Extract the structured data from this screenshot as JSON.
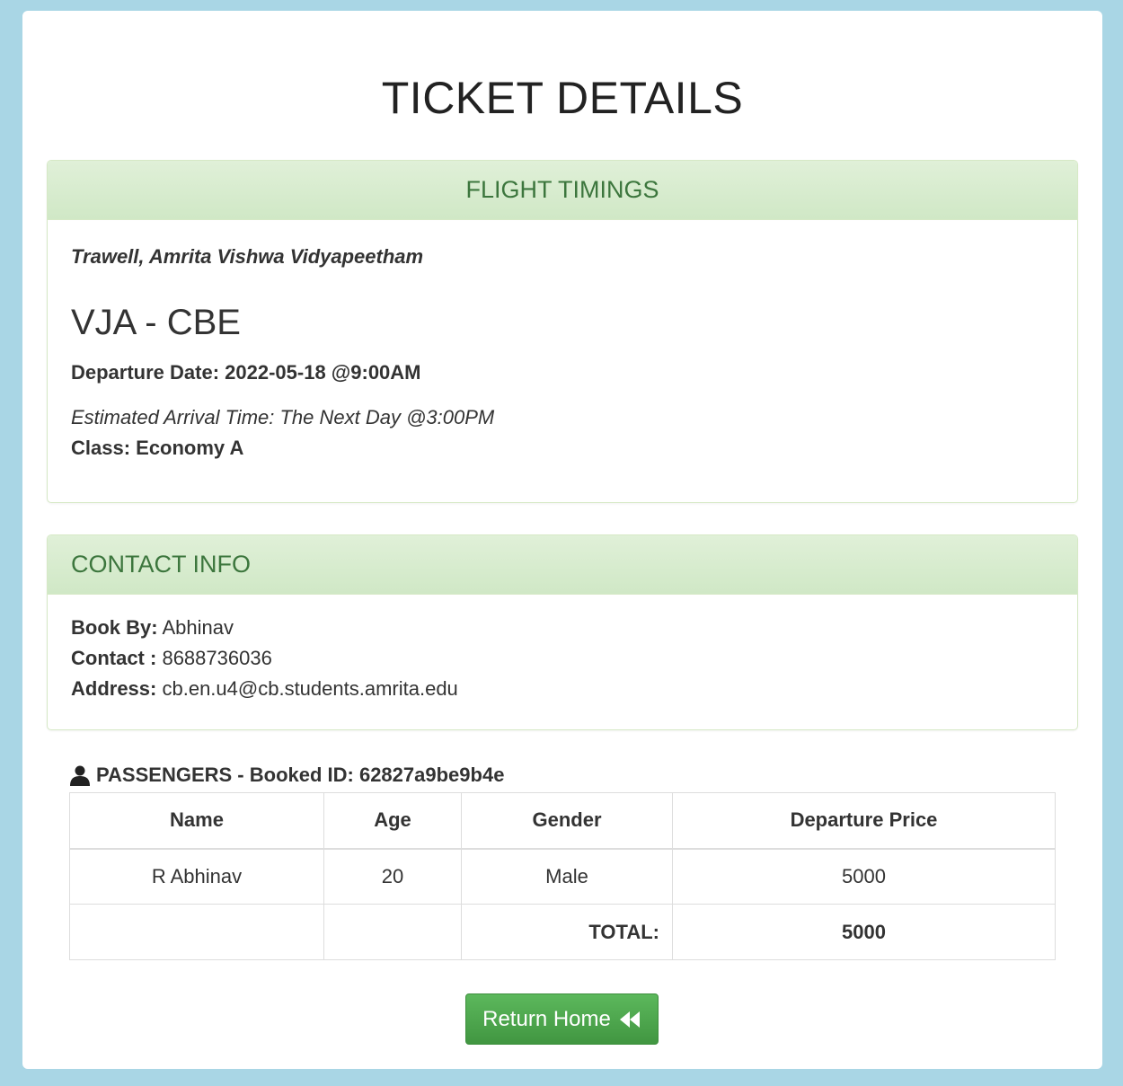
{
  "page": {
    "title": "TICKET DETAILS"
  },
  "flight": {
    "heading": "FLIGHT TIMINGS",
    "org": "Trawell, Amrita Vishwa Vidyapeetham",
    "route": "VJA - CBE",
    "departure": "Departure Date: 2022-05-18 @9:00AM",
    "arrival": "Estimated Arrival Time: The Next Day @3:00PM",
    "class": "Class: Economy A"
  },
  "contact": {
    "heading": "CONTACT INFO",
    "book_by_label": "Book By:",
    "book_by_value": "Abhinav",
    "contact_label": "Contact :",
    "contact_value": "8688736036",
    "address_label": "Address:",
    "address_value": "cb.en.u4@cb.students.amrita.edu"
  },
  "passengers": {
    "heading": "PASSENGERS - Booked ID: 62827a9be9b4e",
    "icon": "user-icon",
    "columns": [
      "Name",
      "Age",
      "Gender",
      "Departure Price"
    ],
    "rows": [
      {
        "name": "R Abhinav",
        "age": "20",
        "gender": "Male",
        "price": "5000"
      }
    ],
    "total_label": "TOTAL:",
    "total_value": "5000"
  },
  "actions": {
    "return_home": "Return Home",
    "return_icon": "rewind-icon"
  },
  "colors": {
    "background": "#a9d6e5",
    "panel_heading": "#dff0d8",
    "panel_text": "#3c763d",
    "button": "#5cb85c"
  }
}
